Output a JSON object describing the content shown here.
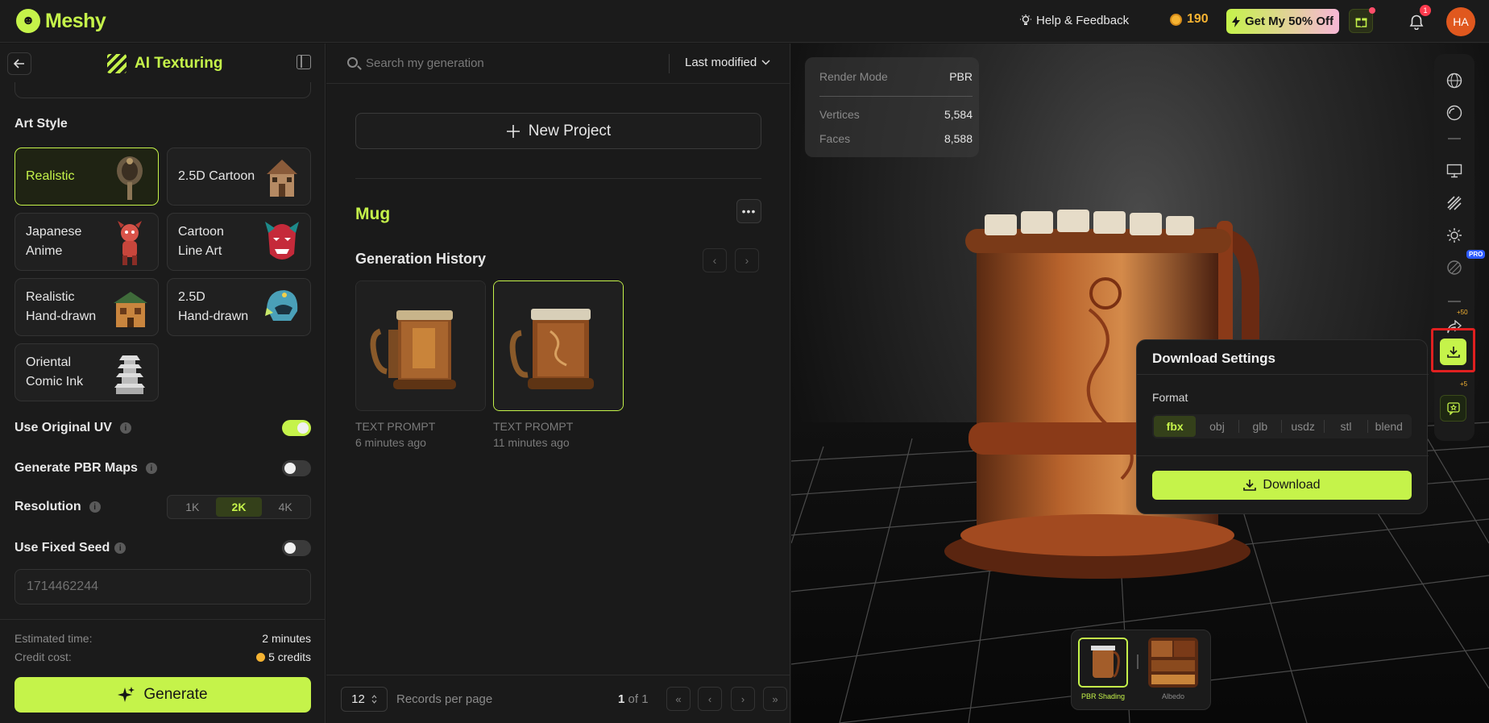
{
  "app": {
    "name": "Meshy",
    "logo_glyph": "☻"
  },
  "header": {
    "help_label": "Help & Feedback",
    "credits": "190",
    "promo_label": "Get My 50% Off",
    "notification_count": "1",
    "avatar_initials": "HA",
    "accent_color": "#c5f34a"
  },
  "left_panel": {
    "title": "AI Texturing",
    "art_style_label": "Art Style",
    "styles": [
      {
        "label1": "Realistic",
        "label2": "",
        "selected": true
      },
      {
        "label1": "2.5D Cartoon",
        "label2": "",
        "selected": false
      },
      {
        "label1": "Japanese",
        "label2": "Anime",
        "selected": false
      },
      {
        "label1": "Cartoon",
        "label2": "Line Art",
        "selected": false
      },
      {
        "label1": "Realistic",
        "label2": "Hand-drawn",
        "selected": false
      },
      {
        "label1": "2.5D",
        "label2": "Hand-drawn",
        "selected": false
      },
      {
        "label1": "Oriental",
        "label2": "Comic Ink",
        "selected": false
      }
    ],
    "use_original_uv": {
      "label": "Use Original UV",
      "on": true
    },
    "generate_pbr": {
      "label": "Generate PBR Maps",
      "on": false
    },
    "resolution": {
      "label": "Resolution",
      "options": [
        "1K",
        "2K",
        "4K"
      ],
      "selected": "2K"
    },
    "fixed_seed": {
      "label": "Use Fixed Seed",
      "on": false
    },
    "seed_placeholder": "1714462244",
    "estimated_time_label": "Estimated time:",
    "estimated_time_value": "2 minutes",
    "credit_cost_label": "Credit cost:",
    "credit_cost_value": "5 credits",
    "generate_label": "Generate"
  },
  "middle_panel": {
    "search_placeholder": "Search my generation",
    "sort_label": "Last modified",
    "new_project_label": "New Project",
    "project_name": "Mug",
    "history_title": "Generation History",
    "generations": [
      {
        "type": "TEXT PROMPT",
        "time": "6 minutes ago",
        "selected": false
      },
      {
        "type": "TEXT PROMPT",
        "time": "11 minutes ago",
        "selected": true
      }
    ],
    "per_page": "12",
    "records_label": "Records per page",
    "page_current": "1",
    "page_of": "of 1"
  },
  "viewport": {
    "render_mode_label": "Render Mode",
    "render_mode_value": "PBR",
    "vertices_label": "Vertices",
    "vertices_value": "5,584",
    "faces_label": "Faces",
    "faces_value": "8,588",
    "pro_tag": "PRO",
    "share_bonus": "+50",
    "fav_bonus": "+5",
    "download_settings": {
      "title": "Download Settings",
      "format_label": "Format",
      "formats": [
        "fbx",
        "obj",
        "glb",
        "usdz",
        "stl",
        "blend"
      ],
      "selected_format": "fbx",
      "download_label": "Download"
    },
    "materials": [
      {
        "label": "PBR Shading",
        "selected": true
      },
      {
        "label": "Albedo",
        "selected": false
      }
    ]
  }
}
